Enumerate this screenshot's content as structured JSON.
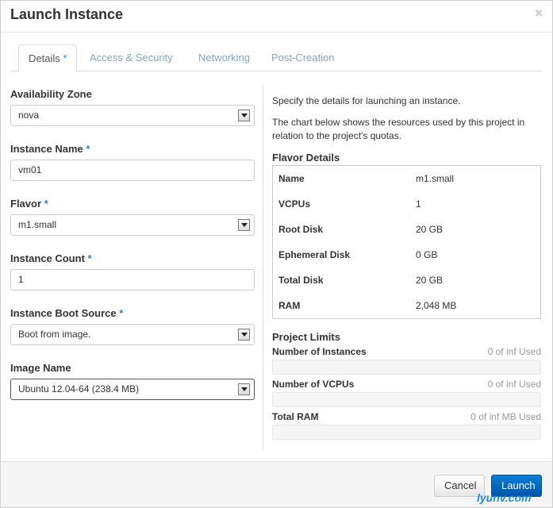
{
  "modal": {
    "title": "Launch Instance",
    "close_label": "×"
  },
  "tabs": [
    {
      "label": "Details",
      "required": "*"
    },
    {
      "label": "Access & Security"
    },
    {
      "label": "Networking"
    },
    {
      "label": "Post-Creation"
    }
  ],
  "form": {
    "availability_zone": {
      "label": "Availability Zone",
      "value": "nova"
    },
    "instance_name": {
      "label": "Instance Name",
      "required": "*",
      "value": "vm01"
    },
    "flavor": {
      "label": "Flavor",
      "required": "*",
      "value": "m1.small"
    },
    "instance_count": {
      "label": "Instance Count",
      "required": "*",
      "value": "1"
    },
    "boot_source": {
      "label": "Instance Boot Source",
      "required": "*",
      "value": "Boot from image."
    },
    "image_name": {
      "label": "Image Name",
      "value": "Ubuntu 12.04-64 (238.4 MB)"
    }
  },
  "info": {
    "desc1": "Specify the details for launching an instance.",
    "desc2": "The chart below shows the resources used by this project in relation to the project's quotas.",
    "flavor_title": "Flavor Details",
    "flavor_rows": [
      {
        "key": "Name",
        "value": "m1.small"
      },
      {
        "key": "VCPUs",
        "value": "1"
      },
      {
        "key": "Root Disk",
        "value": "20 GB"
      },
      {
        "key": "Ephemeral Disk",
        "value": "0 GB"
      },
      {
        "key": "Total Disk",
        "value": "20 GB"
      },
      {
        "key": "RAM",
        "value": "2,048 MB"
      }
    ],
    "limits_title": "Project Limits",
    "limits": [
      {
        "name": "Number of Instances",
        "used": "0 of inf Used"
      },
      {
        "name": "Number of VCPUs",
        "used": "0 of inf Used"
      },
      {
        "name": "Total RAM",
        "used": "0 of inf MB Used"
      }
    ]
  },
  "footer": {
    "cancel_label": "Cancel",
    "launch_label": "Launch"
  },
  "watermark": "lyunv.com",
  "colors": {
    "required": "#3a87ad",
    "tab_inactive": "#8aa4b8",
    "primary": "#0066c0"
  }
}
